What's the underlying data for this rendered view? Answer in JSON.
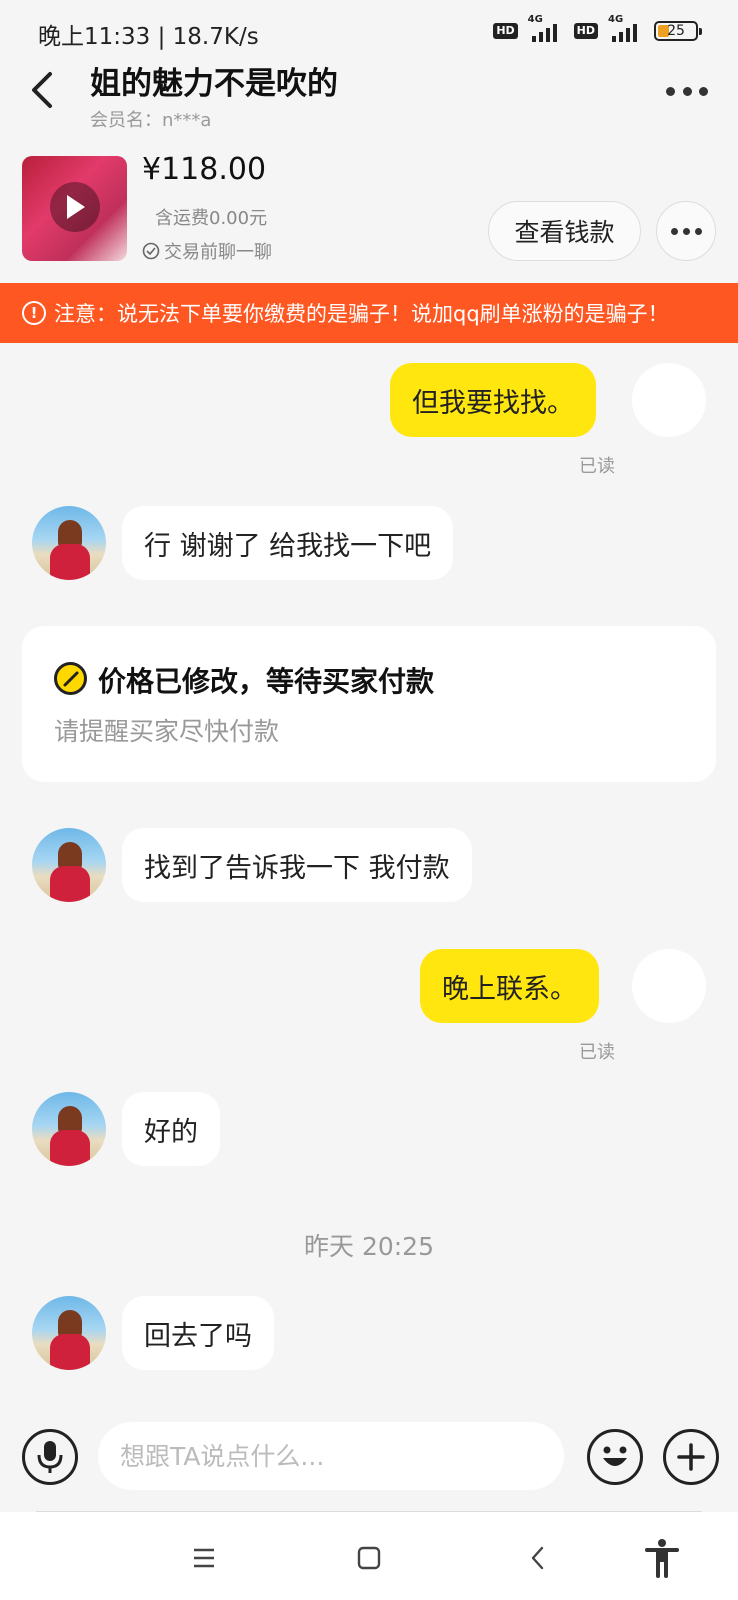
{
  "status_bar": {
    "time_speed": "晚上11:33 | 18.7K/s",
    "hd_label": "HD",
    "network_label": "4G",
    "battery_level": "25"
  },
  "header": {
    "title": "姐的魅力不是吹的",
    "member_name": "会员名：n***a"
  },
  "product": {
    "price": "¥118.00",
    "shipping": "含运费0.00元",
    "chat_hint": "交易前聊一聊",
    "view_payment_label": "查看钱款"
  },
  "warning": {
    "text": "注意：说无法下单要你缴费的是骗子！说加qq刷单涨粉的是骗子！"
  },
  "messages": {
    "m1": {
      "text": "但我要找找。",
      "status": "已读"
    },
    "m2": {
      "text": "行 谢谢了 给我找一下吧"
    },
    "system_card": {
      "title": "价格已修改，等待买家付款",
      "subtitle": "请提醒买家尽快付款"
    },
    "m3": {
      "text": "找到了告诉我一下 我付款"
    },
    "m4": {
      "text": "晚上联系。",
      "status": "已读"
    },
    "m5": {
      "text": "好的"
    },
    "timestamp": "昨天 20:25",
    "m6": {
      "text": "回去了吗"
    }
  },
  "input_bar": {
    "placeholder": "想跟TA说点什么..."
  },
  "colors": {
    "outgoing_bubble": "#ffe60f",
    "warning_banner": "#ff5722",
    "background": "#f5f5f5"
  }
}
